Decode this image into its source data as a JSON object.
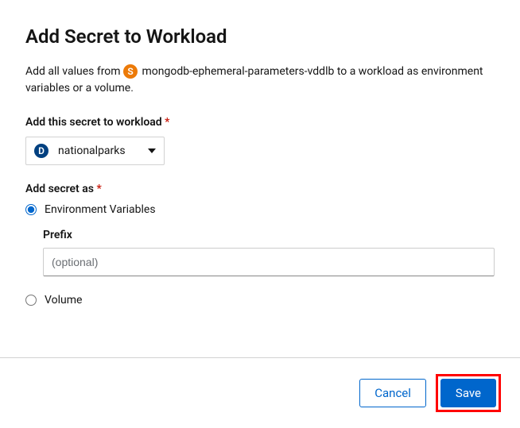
{
  "title": "Add Secret to Workload",
  "description": {
    "prefix": "Add all values from ",
    "badge_letter": "S",
    "secret_name": "mongodb-ephemeral-parameters-vddlb",
    "suffix": " to a workload as environment variables or a volume."
  },
  "workload_field": {
    "label": "Add this secret to workload",
    "badge_letter": "D",
    "selected": "nationalparks"
  },
  "secret_as_field": {
    "label": "Add secret as",
    "option_env": "Environment Variables",
    "option_volume": "Volume",
    "prefix_label": "Prefix",
    "prefix_placeholder": "(optional)"
  },
  "buttons": {
    "cancel": "Cancel",
    "save": "Save"
  }
}
